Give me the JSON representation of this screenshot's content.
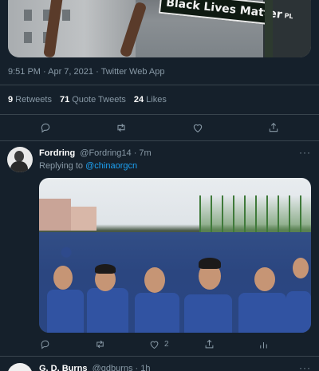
{
  "top_tweet": {
    "media_sign_text": "Black Lives Matter",
    "media_sign_suffix": "PL",
    "meta": "9:51 PM · Apr 7, 2021 · Twitter Web App",
    "stats": {
      "retweets_count": "9",
      "retweets_label": "Retweets",
      "quotes_count": "71",
      "quotes_label": "Quote Tweets",
      "likes_count": "24",
      "likes_label": "Likes"
    },
    "actions": [
      "reply-icon",
      "retweet-icon",
      "like-icon",
      "share-icon"
    ]
  },
  "reply_tweet": {
    "display_name": "Fordring",
    "handle_time": "@Fordring14 · 7m",
    "more": "···",
    "replying_prefix": "Replying to",
    "replying_handle": "@chinaorgcn",
    "like_count": "2",
    "actions": [
      "reply-icon",
      "retweet-icon",
      "like-icon",
      "share-icon",
      "analytics-icon"
    ]
  },
  "next_tweet": {
    "display_name": "G. D. Burns",
    "handle_time": "@gdburns · 1h",
    "more": "···"
  },
  "colors": {
    "background": "#15202b",
    "secondary_text": "#8899a6",
    "link": "#1da1f2",
    "divider": "#38444d"
  }
}
